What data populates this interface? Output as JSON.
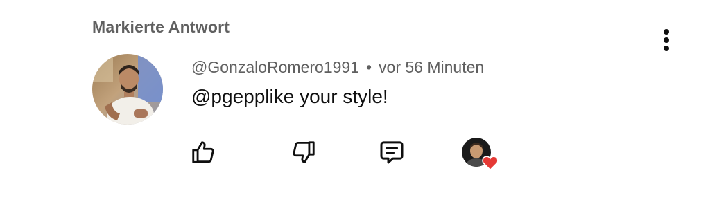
{
  "header": {
    "section_label": "Markierte Antwort"
  },
  "comment": {
    "author": "@GonzaloRomero1991",
    "separator": "•",
    "timestamp": "vor 56 Minuten",
    "text": "@pgepplike your style!"
  },
  "actions": {
    "like_icon": "thumbs-up-icon",
    "dislike_icon": "thumbs-down-icon",
    "reply_icon": "reply-comment-icon",
    "creator_heart_icon": "heart-icon"
  },
  "colors": {
    "heart": "#e53935",
    "secondary_text": "#606060",
    "primary_text": "#0f0f0f"
  }
}
